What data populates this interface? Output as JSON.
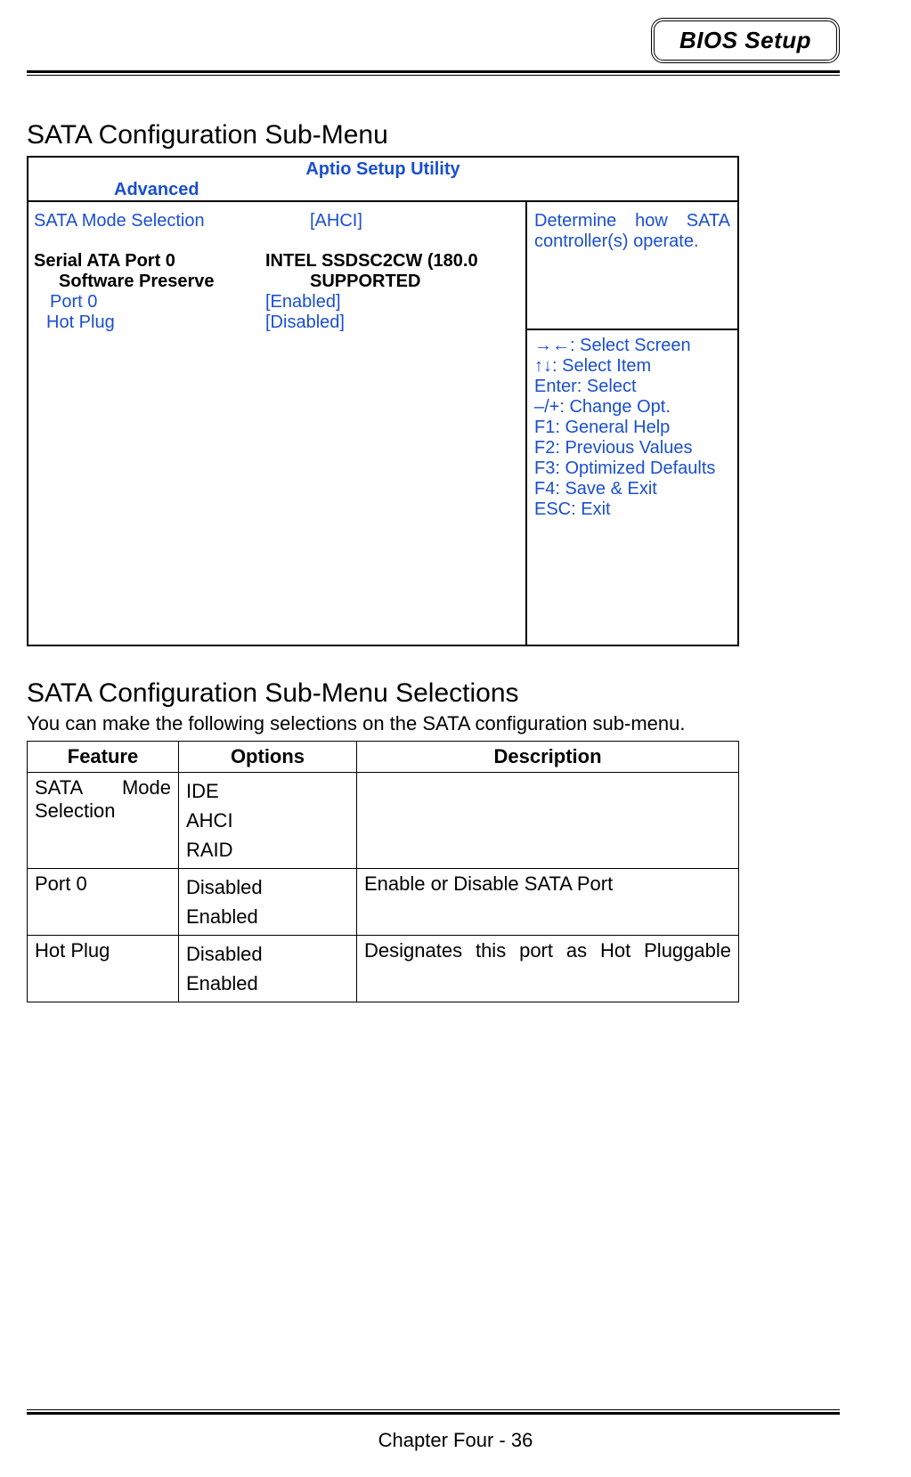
{
  "header": {
    "badge": "BIOS Setup"
  },
  "section1": {
    "title": "SATA Configuration Sub-Menu",
    "utility_title": "Aptio Setup Utility",
    "tab": "Advanced",
    "left": {
      "sata_mode_label": "SATA Mode Selection",
      "sata_mode_value": "[AHCI]",
      "serial_ata_label": "Serial ATA Port 0",
      "serial_ata_value": "INTEL SSDSC2CW (180.0",
      "software_preserve_label": "Software Preserve",
      "software_preserve_value": "SUPPORTED",
      "port0_label": "Port 0",
      "port0_value": "[Enabled]",
      "hotplug_label": "Hot Plug",
      "hotplug_value": "[Disabled]"
    },
    "right": {
      "help_text": "Determine how SATA controller(s) operate.",
      "keys": [
        "→←: Select Screen",
        "↑↓: Select Item",
        "Enter: Select",
        "–/+: Change Opt.",
        "F1: General Help",
        "F2: Previous Values",
        "F3: Optimized Defaults",
        "F4: Save & Exit",
        "ESC: Exit"
      ]
    }
  },
  "section2": {
    "title": "SATA Configuration Sub-Menu Selections",
    "intro": "You can make the following selections on the SATA configuration sub-menu.",
    "headers": {
      "feature": "Feature",
      "options": "Options",
      "description": "Description"
    },
    "rows": [
      {
        "feature": "SATA Mode Selection",
        "options": [
          "IDE",
          "AHCI",
          "RAID"
        ],
        "description": ""
      },
      {
        "feature": "Port 0",
        "options": [
          "Disabled",
          "Enabled"
        ],
        "description": "Enable or Disable SATA Port"
      },
      {
        "feature": "Hot Plug",
        "options": [
          "Disabled",
          "Enabled"
        ],
        "description": "Designates this port as Hot Pluggable"
      }
    ]
  },
  "footer": {
    "text": "Chapter Four - 36"
  }
}
